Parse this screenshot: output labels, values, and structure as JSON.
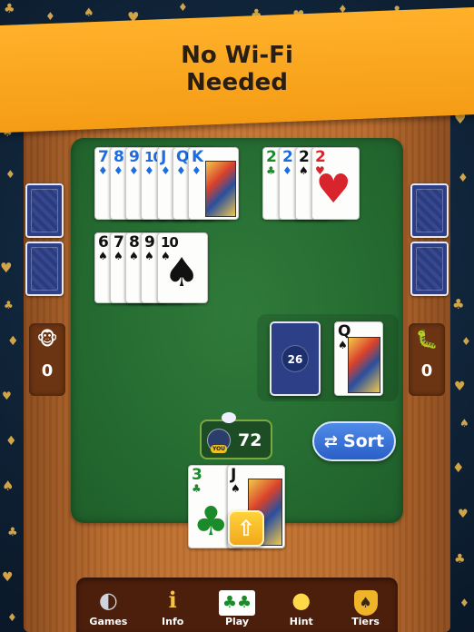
{
  "banner": {
    "line1": "No Wi-Fi",
    "line2": "Needed"
  },
  "melds": {
    "diamonds_run": [
      {
        "rank": "7",
        "suit": "♦"
      },
      {
        "rank": "8",
        "suit": "♦"
      },
      {
        "rank": "9",
        "suit": "♦"
      },
      {
        "rank": "10",
        "suit": "♦"
      },
      {
        "rank": "J",
        "suit": "♦"
      },
      {
        "rank": "Q",
        "suit": "♦"
      },
      {
        "rank": "K",
        "suit": "♦"
      }
    ],
    "twos_set": [
      {
        "rank": "2",
        "suit": "♣",
        "color": "green"
      },
      {
        "rank": "2",
        "suit": "♦",
        "color": "blue"
      },
      {
        "rank": "2",
        "suit": "♠",
        "color": "black"
      },
      {
        "rank": "2",
        "suit": "♥",
        "color": "red"
      }
    ],
    "spades_run": [
      {
        "rank": "6",
        "suit": "♠"
      },
      {
        "rank": "7",
        "suit": "♠"
      },
      {
        "rank": "8",
        "suit": "♠"
      },
      {
        "rank": "9",
        "suit": "♠"
      },
      {
        "rank": "10",
        "suit": "♠"
      }
    ]
  },
  "opponents": {
    "left": {
      "avatar": "monkey-icon",
      "glyph": "🐵",
      "score": "0"
    },
    "right": {
      "avatar": "worm-icon",
      "glyph": "🐛",
      "score": "0"
    }
  },
  "deck": {
    "count": "26"
  },
  "discard": {
    "rank": "Q",
    "suit": "♠"
  },
  "player": {
    "score": "72",
    "badge": "YOU"
  },
  "sort_button": {
    "label": "Sort",
    "icon": "⇄"
  },
  "hand": [
    {
      "rank": "3",
      "suit": "♣",
      "color": "green"
    },
    {
      "rank": "J",
      "suit": "♠",
      "color": "black"
    }
  ],
  "nav": [
    {
      "label": "Games",
      "icon": "games-icon",
      "glyph": "🂠"
    },
    {
      "label": "Info",
      "icon": "info-icon",
      "glyph": "ℹ"
    },
    {
      "label": "Play",
      "icon": "play-cards-icon",
      "glyph": "♣"
    },
    {
      "label": "Hint",
      "icon": "lightbulb-icon",
      "glyph": "💡"
    },
    {
      "label": "Tiers",
      "icon": "tiers-badge-icon",
      "glyph": "♠"
    }
  ],
  "colors": {
    "banner": "#f7a11a",
    "felt": "#2a6f34",
    "wood": "#b86a2c",
    "sort_button": "#3a74d8",
    "nav_bg": "#4c1e0c"
  }
}
